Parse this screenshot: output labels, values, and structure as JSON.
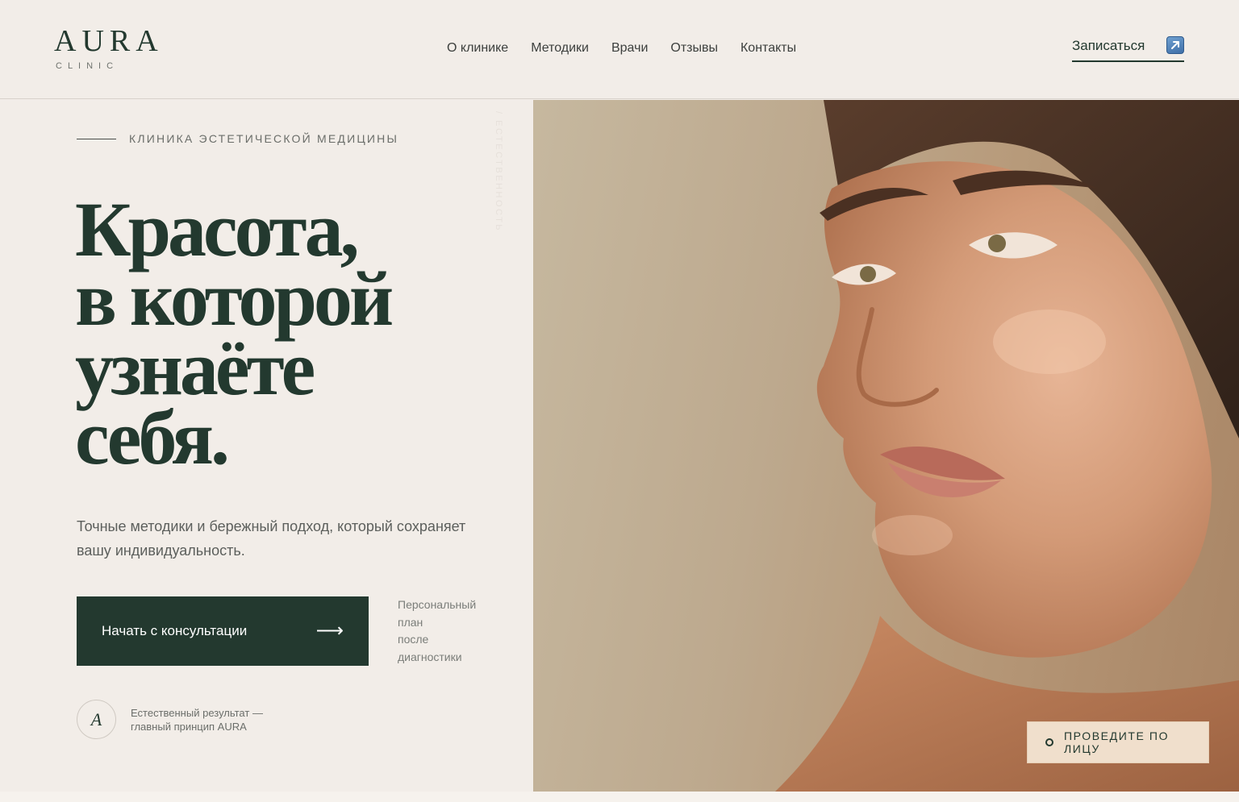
{
  "brand": {
    "name": "AURA",
    "subtitle": "CLINIC"
  },
  "nav": {
    "items": [
      "О клинике",
      "Методики",
      "Врачи",
      "Отзывы",
      "Контакты"
    ],
    "book_label": "Записаться",
    "book_icon": "arrow-up-right-icon"
  },
  "hero": {
    "eyebrow": "КЛИНИКА ЭСТЕТИЧЕСКОЙ МЕДИЦИНЫ",
    "vertical_label": "/ ЕСТЕСТВЕННОСТЬ",
    "headline": [
      "Красота,",
      "в которой",
      "узнаёте",
      "себя."
    ],
    "lead": "Точные методики и бережный подход, который сохраняет вашу индивидуальность.",
    "cta_label": "Начать с консультации",
    "cta_arrow": "⟶",
    "note": [
      "Персональный",
      "план",
      "после",
      "диагностики"
    ],
    "badge_letter": "A",
    "badge_text": [
      "Естественный результат —",
      "главный принцип AURA"
    ]
  },
  "photo": {
    "face_cta_label": "ПРОВЕДИТЕ ПО ЛИЦУ"
  },
  "colors": {
    "background": "#f2ede8",
    "primary": "#23392f",
    "muted_text": "#6b6e6a",
    "photo_cta_bg": "#f0dfcc"
  }
}
